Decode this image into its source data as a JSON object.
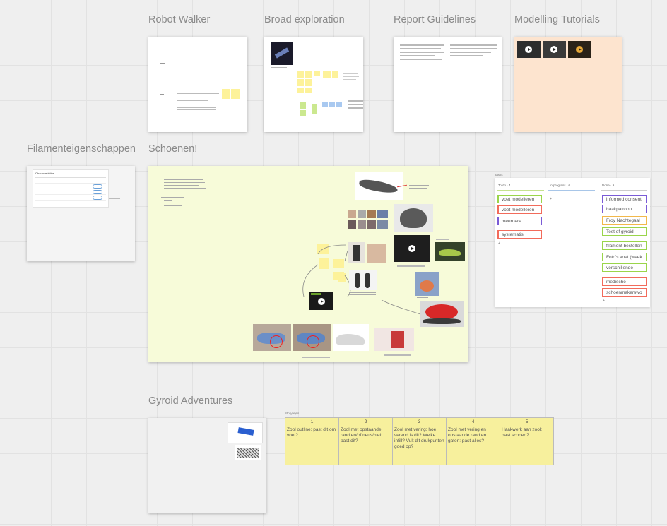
{
  "frames": {
    "robot_walker": {
      "title": "Robot Walker"
    },
    "broad_exploration": {
      "title": "Broad exploration"
    },
    "report_guidelines": {
      "title": "Report Guidelines"
    },
    "modelling_tutorials": {
      "title": "Modelling Tutorials"
    },
    "filament": {
      "title": "Filamenteigenschappen",
      "table_title": "Characteristics"
    },
    "schoenen": {
      "title": "Schoenen!"
    },
    "gyroid": {
      "title": "Gyroid Adventures"
    }
  },
  "kanban": {
    "label": "Tasks",
    "columns": [
      {
        "header": "To do",
        "count": "4",
        "cards": [
          {
            "text": "voet modelleren",
            "color": "#9ad54a"
          },
          {
            "text": "voet modelleren",
            "color": "#f26b5b"
          },
          {
            "text": "meerdere",
            "color": "#7a5bd6"
          },
          {
            "text": "systematis",
            "color": "#f26b5b"
          }
        ]
      },
      {
        "header": "In progress",
        "count": "0",
        "cards": []
      },
      {
        "header": "Done",
        "count": "9",
        "cards": [
          {
            "text": "informed consent",
            "color": "#7a5bd6"
          },
          {
            "text": "haakpatroon",
            "color": "#7a5bd6"
          },
          {
            "text": "Froy Nachtegaal",
            "color": "#f2b84b"
          },
          {
            "text": "Test of gyroid",
            "color": "#9ad54a"
          },
          {
            "text": "filament bestellen",
            "color": "#9ad54a"
          },
          {
            "text": "Foto's voet (week",
            "color": "#9ad54a"
          },
          {
            "text": "verschillende",
            "color": "#9ad54a"
          },
          {
            "text": "medische",
            "color": "#f26b5b"
          },
          {
            "text": "schoenmakerswo",
            "color": "#f26b5b"
          }
        ]
      }
    ]
  },
  "storymap": {
    "label": "Storyrejes",
    "columns": [
      {
        "num": "1",
        "text": "Zool outline: past dit om voet?"
      },
      {
        "num": "2",
        "text": "Zool met opstaande rand en/of neus/hiel: past dit?"
      },
      {
        "num": "3",
        "text": "Zool met vering: hoe verend is dit? Welke infill? Vult dit drukpunten goed op?"
      },
      {
        "num": "4",
        "text": "Zool met vering en opstaande rand en gaten: past alles?"
      },
      {
        "num": "5",
        "text": "Haakwerk aan zool: past schoen?"
      }
    ]
  }
}
